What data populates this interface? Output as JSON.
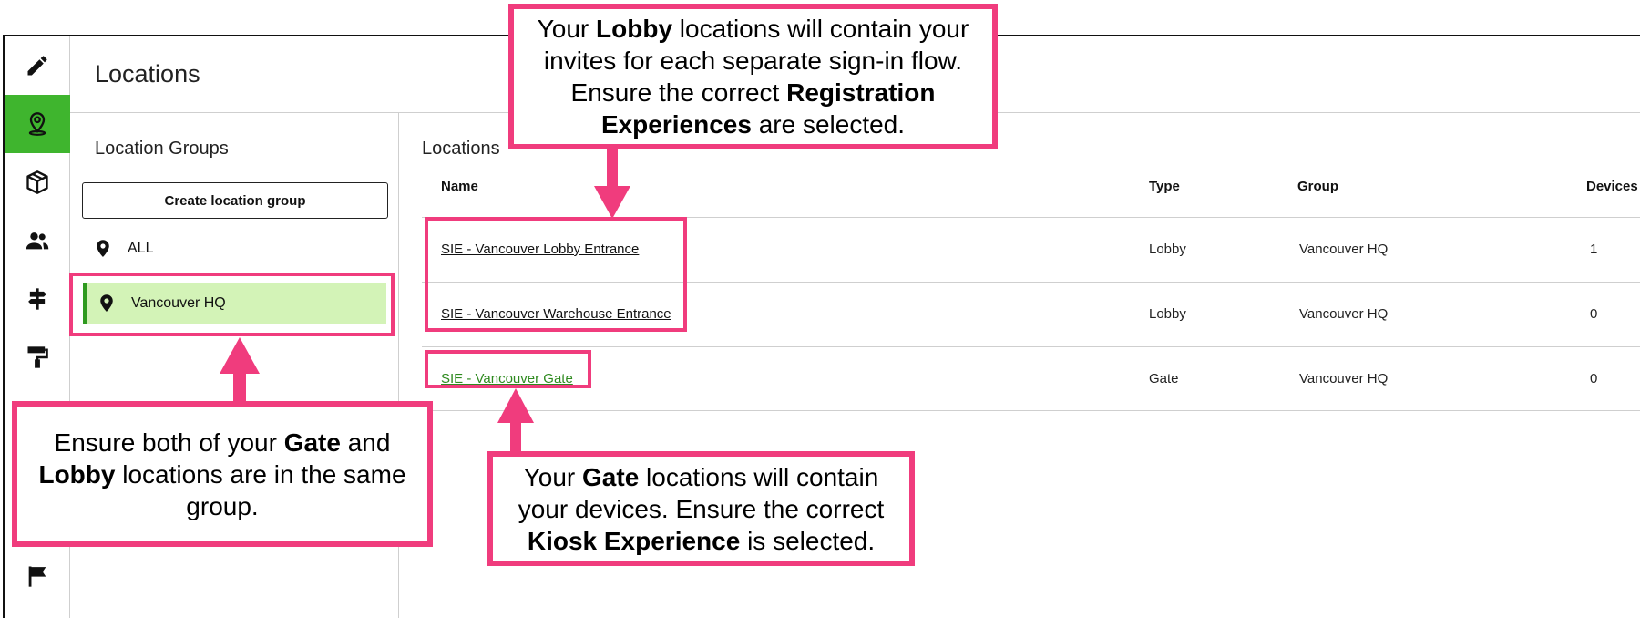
{
  "page_title": "Locations",
  "sidebar": {
    "items": [
      {
        "name": "pencil-icon",
        "active": false
      },
      {
        "name": "location-pin-icon",
        "active": true
      },
      {
        "name": "box-icon",
        "active": false
      },
      {
        "name": "people-icon",
        "active": false
      },
      {
        "name": "signpost-icon",
        "active": false
      },
      {
        "name": "paint-roller-icon",
        "active": false
      },
      {
        "name": "flag-icon",
        "active": false
      }
    ],
    "active_color": "#3fb52e"
  },
  "groups": {
    "title": "Location Groups",
    "create_label": "Create location group",
    "items": [
      {
        "label": "ALL",
        "selected": false
      },
      {
        "label": "Vancouver HQ",
        "selected": true
      }
    ]
  },
  "locations": {
    "title": "Locations",
    "columns": [
      "Name",
      "Type",
      "Group",
      "Devices"
    ],
    "rows": [
      {
        "name": "SIE - Vancouver Lobby Entrance",
        "type": "Lobby",
        "group": "Vancouver HQ",
        "devices": "1"
      },
      {
        "name": "SIE - Vancouver Warehouse Entrance",
        "type": "Lobby",
        "group": "Vancouver HQ",
        "devices": "0"
      },
      {
        "name": "SIE - Vancouver Gate",
        "type": "Gate",
        "group": "Vancouver HQ",
        "devices": "0"
      }
    ]
  },
  "annotations": {
    "highlight_color": "#f03c7d",
    "lobby_note": {
      "t1": "Your ",
      "b1": "Lobby",
      "t2": " locations will contain your invites for each separate sign-in flow. Ensure the correct ",
      "b2": "Registration Experiences",
      "t3": " are selected."
    },
    "group_note": {
      "t1": "Ensure both of your ",
      "b1": "Gate",
      "t2": " and ",
      "b2": "Lobby",
      "t3": " locations are in the same group."
    },
    "gate_note": {
      "t1": "Your ",
      "b1": "Gate",
      "t2": " locations will contain your devices. Ensure the correct ",
      "b2": "Kiosk Experience",
      "t3": " is selected."
    }
  }
}
